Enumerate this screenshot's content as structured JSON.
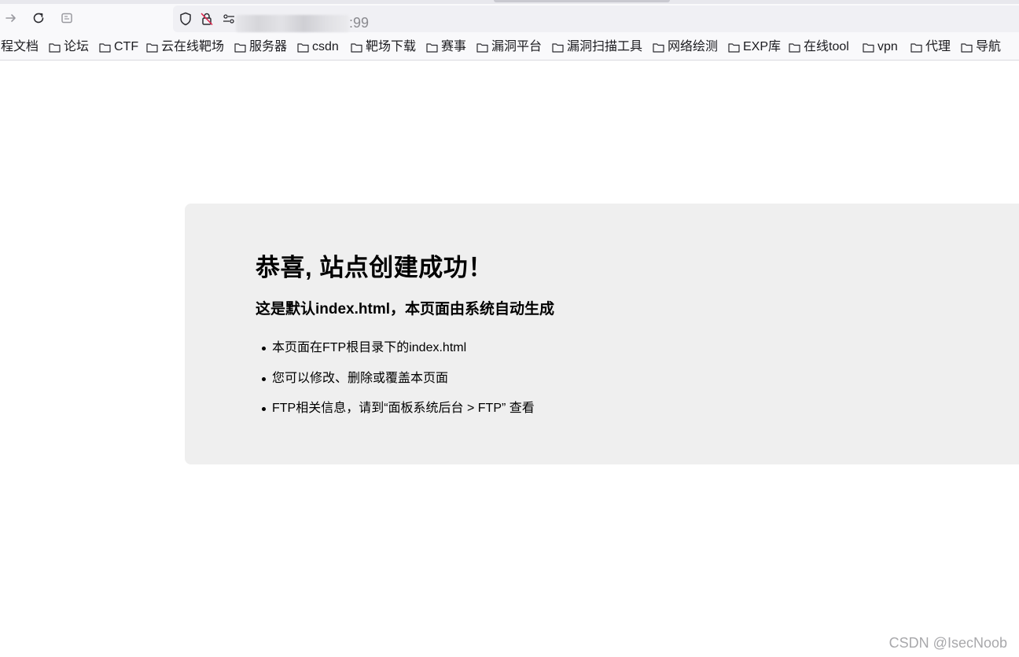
{
  "browser": {
    "nav": {
      "forward_icon": "arrow-right-icon",
      "reload_icon": "reload-icon",
      "reader_icon": "reader-view-icon"
    },
    "urlbar": {
      "shield_icon": "shield-icon",
      "insecure_icon": "insecure-lock-icon",
      "permissions_icon": "permissions-icon",
      "port_text": ":99"
    },
    "bookmarks": [
      "程文档",
      "论坛",
      "CTF",
      "云在线靶场",
      "服务器",
      "csdn",
      "靶场下载",
      "赛事",
      "漏洞平台",
      "漏洞扫描工具",
      "网络绘测",
      "EXP库",
      "在线tool",
      "vpn",
      "代理",
      "导航"
    ]
  },
  "page": {
    "title": "恭喜, 站点创建成功！",
    "subtitle": "这是默认index.html，本页面由系统自动生成",
    "items": [
      "本页面在FTP根目录下的index.html",
      "您可以修改、删除或覆盖本页面",
      "FTP相关信息，请到“面板系统后台 > FTP” 查看"
    ]
  },
  "watermark": "CSDN @IsecNoob",
  "colors": {
    "card_bg": "#efefef",
    "toolbar_bg": "#f9f9fb",
    "urlbar_bg": "#f0f0f4"
  }
}
